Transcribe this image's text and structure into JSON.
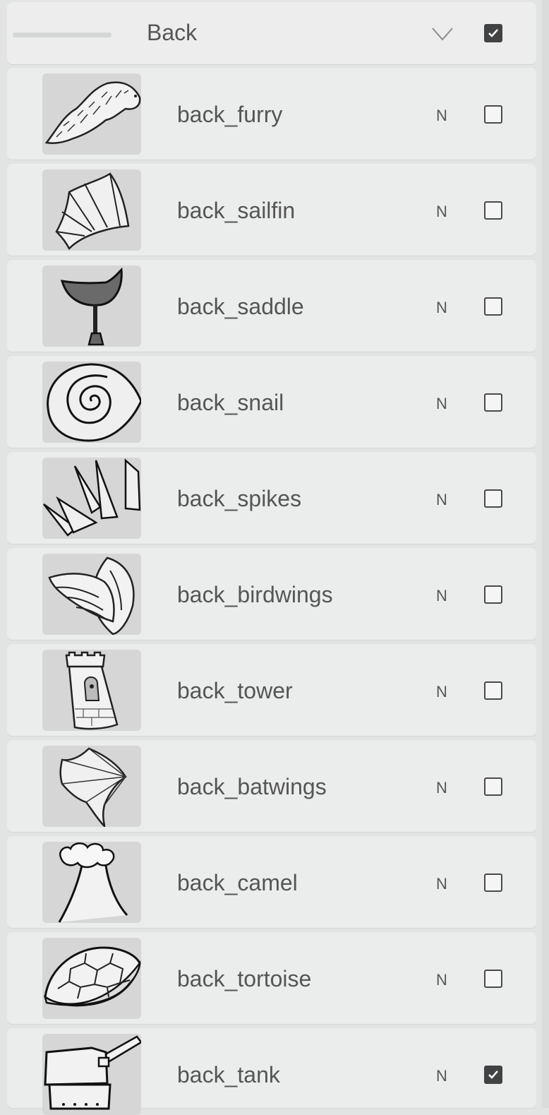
{
  "group": {
    "name": "Back",
    "visible": true,
    "icons": {
      "collapse": "chevron-down-icon",
      "checkbox": "checkbox-checked-icon"
    }
  },
  "layers": [
    {
      "name": "back_furry",
      "blend": "N",
      "visible": false,
      "thumb_icon": "fur-tuft-icon"
    },
    {
      "name": "back_sailfin",
      "blend": "N",
      "visible": false,
      "thumb_icon": "sailfin-icon"
    },
    {
      "name": "back_saddle",
      "blend": "N",
      "visible": false,
      "thumb_icon": "saddle-icon"
    },
    {
      "name": "back_snail",
      "blend": "N",
      "visible": false,
      "thumb_icon": "snail-shell-icon"
    },
    {
      "name": "back_spikes",
      "blend": "N",
      "visible": false,
      "thumb_icon": "spikes-icon"
    },
    {
      "name": "back_birdwings",
      "blend": "N",
      "visible": false,
      "thumb_icon": "bird-wings-icon"
    },
    {
      "name": "back_tower",
      "blend": "N",
      "visible": false,
      "thumb_icon": "tower-icon"
    },
    {
      "name": "back_batwings",
      "blend": "N",
      "visible": false,
      "thumb_icon": "bat-wing-icon"
    },
    {
      "name": "back_camel",
      "blend": "N",
      "visible": false,
      "thumb_icon": "camel-hump-icon"
    },
    {
      "name": "back_tortoise",
      "blend": "N",
      "visible": false,
      "thumb_icon": "tortoise-shell-icon"
    },
    {
      "name": "back_tank",
      "blend": "N",
      "visible": true,
      "thumb_icon": "tank-turret-icon"
    }
  ],
  "colors": {
    "panel_bg": "#e2e4e4",
    "row_bg": "#ebecec",
    "thumb_bg": "#d6d6d6",
    "checked": "#404244"
  }
}
